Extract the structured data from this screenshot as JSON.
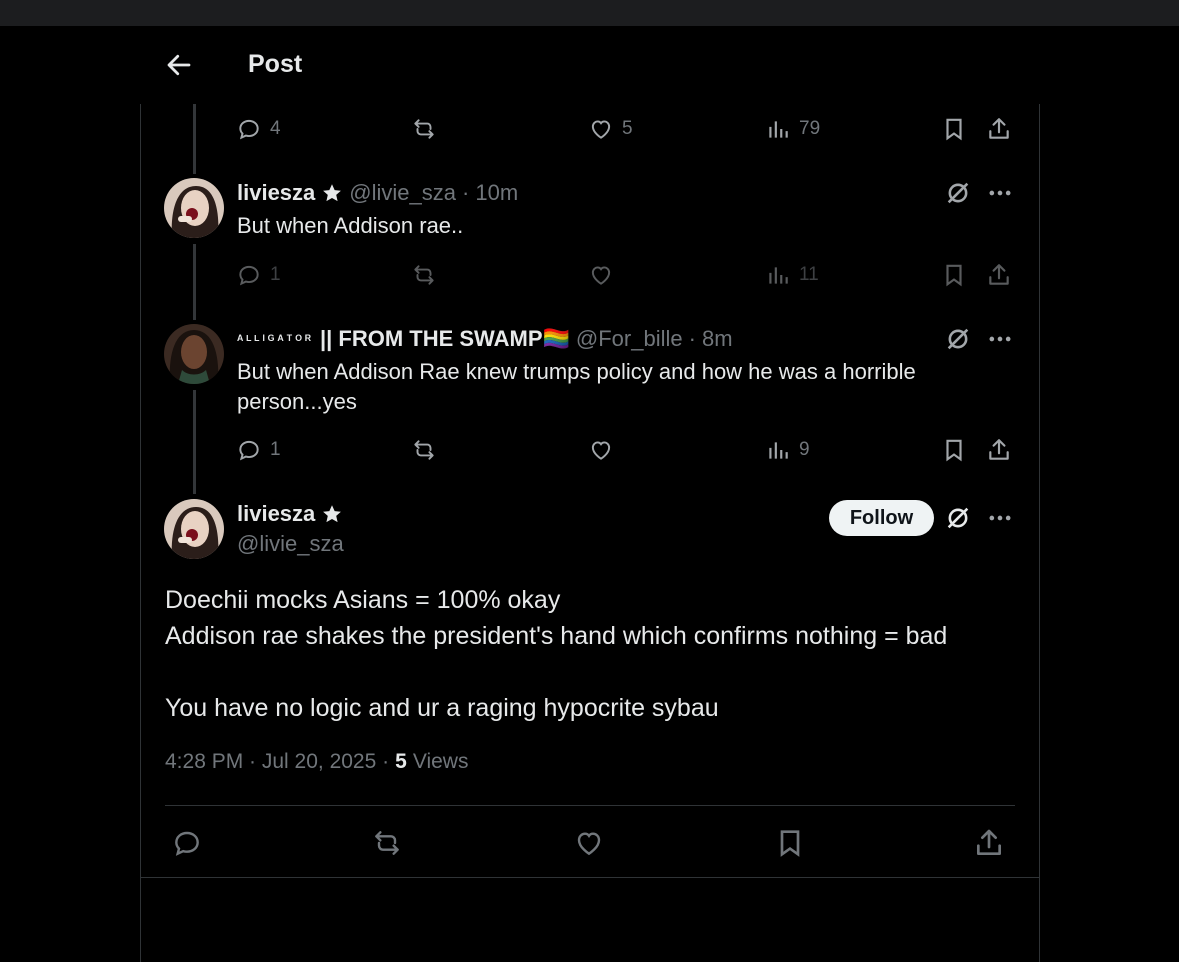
{
  "header": {
    "title": "Post"
  },
  "icons": {
    "back": "arrow-left-icon",
    "reply": "reply-icon",
    "repost": "repost-icon",
    "like": "heart-icon",
    "views": "bar-chart-icon",
    "bookmark": "bookmark-icon",
    "share": "share-icon",
    "grok": "grok-icon",
    "more": "more-icon",
    "verified": "star-icon"
  },
  "top_actions": {
    "replies": "4",
    "likes": "5",
    "views": "79"
  },
  "reply1": {
    "name": "liviesza",
    "handle": "@livie_sza",
    "time": "· 10m",
    "text": "But when Addison rae..",
    "replies": "1",
    "views": "11"
  },
  "reply2": {
    "name_styled": "ᴬᴸᴸᴵᴳᴬᵀᴼᴿ",
    "name_rest": "|| FROM THE SWAMP🏳️‍🌈",
    "handle": "@For_bille",
    "time": "· 8m",
    "text": "But when Addison Rae knew trumps policy and how he was a horrible person...yes",
    "replies": "1",
    "views": "9"
  },
  "main": {
    "name": "liviesza",
    "handle": "@livie_sza",
    "follow_label": "Follow",
    "lines": [
      "Doechii mocks Asians = 100% okay",
      "Addison rae shakes the president's hand which confirms nothing = bad",
      "",
      "You have no logic and ur a raging hypocrite sybau"
    ],
    "timestamp": "4:28 PM · Jul 20, 2025 ·",
    "views_count": "5",
    "views_label": "Views"
  },
  "colors": {
    "background": "#000000",
    "text": "#e7e9ea",
    "secondary": "#71767b",
    "border": "#2f3336",
    "follow_bg": "#eff3f4"
  }
}
